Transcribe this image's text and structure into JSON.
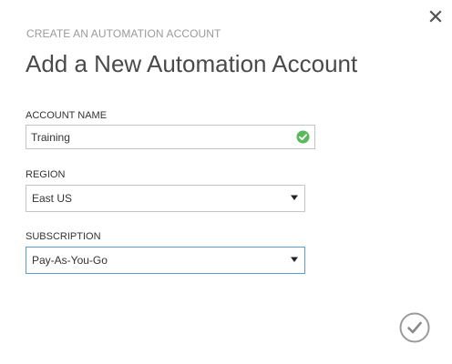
{
  "dialog": {
    "subtitle": "CREATE AN AUTOMATION ACCOUNT",
    "title": "Add a New Automation Account",
    "close_icon": "close-icon",
    "confirm_icon": "checkmark-circle-icon"
  },
  "form": {
    "account_name": {
      "label": "ACCOUNT NAME",
      "value": "Training",
      "status_icon": "valid-check-icon",
      "status_color": "#5cb85c"
    },
    "region": {
      "label": "REGION",
      "selected": "East US",
      "caret_icon": "dropdown-caret-icon"
    },
    "subscription": {
      "label": "SUBSCRIPTION",
      "selected": "Pay-As-You-Go",
      "caret_icon": "dropdown-caret-icon"
    }
  },
  "colors": {
    "focus_border": "#5b9bd5",
    "muted_text": "#9a9a9a",
    "confirm_icon": "#9a9a9a"
  }
}
